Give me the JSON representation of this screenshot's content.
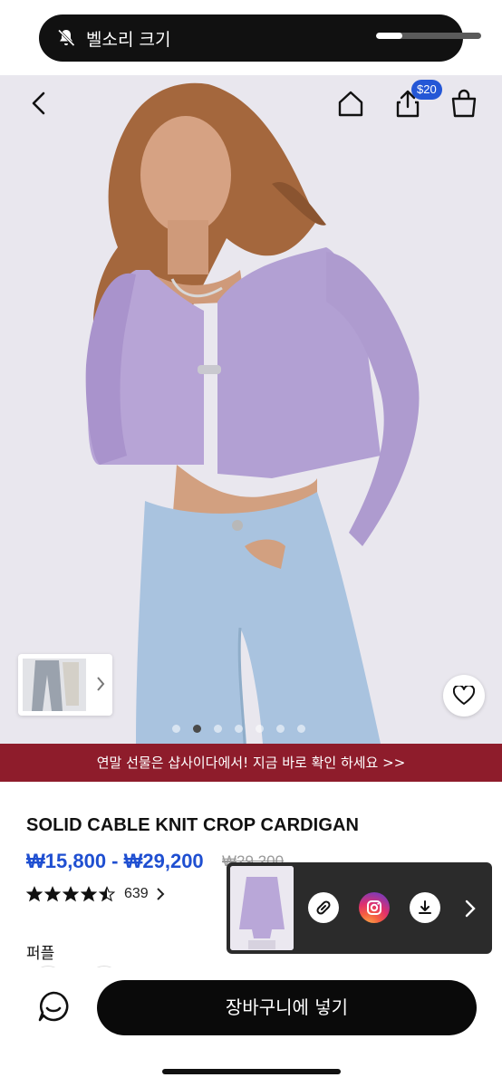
{
  "ringer": {
    "label": "벨소리 크기",
    "volume_fraction": 0.25
  },
  "nav": {
    "share_badge": "$20"
  },
  "promo": {
    "text": "연말 선물은 샵사이다에서! 지금 바로 확인 하세요 >>"
  },
  "product": {
    "title": "SOLID CABLE KNIT CROP CARDIGAN",
    "price_range": "₩15,800 - ₩29,200",
    "original_price": "₩29,200",
    "rating_stars": 4.5,
    "review_count": "639",
    "color_label": "퍼플"
  },
  "gallery": {
    "image_count": 7,
    "active_index": 1
  },
  "bottom": {
    "add_to_cart_label": "장바구니에 넣기"
  },
  "colors": {
    "accent_blue": "#1f4fd1",
    "promo_bg": "#8e1c2b",
    "cardigan": "#b7a4d6",
    "jeans": "#a9c3df"
  }
}
